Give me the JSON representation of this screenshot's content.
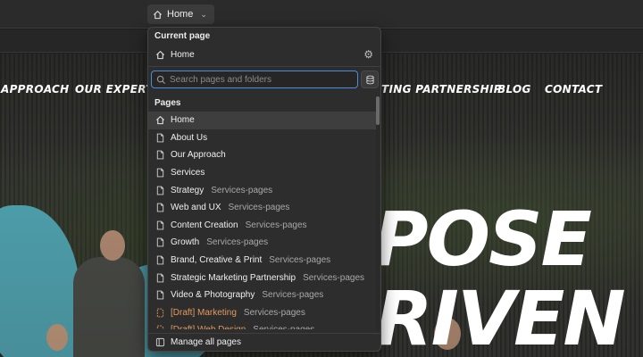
{
  "toolbar": {
    "page_button_label": "Home",
    "page_button_icon": "home-icon"
  },
  "site": {
    "nav": [
      "APPROACH",
      "OUR EXPERTIS",
      "TING PARTNERSHIP",
      "BLOG",
      "CONTACT"
    ],
    "hero_line1": "POSE",
    "hero_line2": "RIVEN"
  },
  "panel": {
    "current_heading": "Current page",
    "current_page": "Home",
    "search_placeholder": "Search pages and folders",
    "pages_heading": "Pages",
    "pages": [
      {
        "label": "Home",
        "sub": "",
        "icon": "home-icon",
        "selected": true,
        "draft": false
      },
      {
        "label": "About Us",
        "sub": "",
        "icon": "page-icon",
        "selected": false,
        "draft": false
      },
      {
        "label": "Our Approach",
        "sub": "",
        "icon": "page-icon",
        "selected": false,
        "draft": false
      },
      {
        "label": "Services",
        "sub": "",
        "icon": "page-icon",
        "selected": false,
        "draft": false
      },
      {
        "label": "Strategy",
        "sub": "Services-pages",
        "icon": "page-icon",
        "selected": false,
        "draft": false
      },
      {
        "label": "Web and UX",
        "sub": "Services-pages",
        "icon": "page-icon",
        "selected": false,
        "draft": false
      },
      {
        "label": "Content Creation",
        "sub": "Services-pages",
        "icon": "page-icon",
        "selected": false,
        "draft": false
      },
      {
        "label": "Growth",
        "sub": "Services-pages",
        "icon": "page-icon",
        "selected": false,
        "draft": false
      },
      {
        "label": "Brand, Creative & Print",
        "sub": "Services-pages",
        "icon": "page-icon",
        "selected": false,
        "draft": false
      },
      {
        "label": "Strategic Marketing Partnership",
        "sub": "Services-pages",
        "icon": "page-icon",
        "selected": false,
        "draft": false
      },
      {
        "label": "Video & Photography",
        "sub": "Services-pages",
        "icon": "page-icon",
        "selected": false,
        "draft": false
      },
      {
        "label": "[Draft] Marketing",
        "sub": "Services-pages",
        "icon": "draft-page-icon",
        "selected": false,
        "draft": true
      },
      {
        "label": "[Draft] Web Design",
        "sub": "Services-pages",
        "icon": "draft-page-icon",
        "selected": false,
        "draft": true
      }
    ],
    "footer_label": "Manage all pages"
  },
  "colors": {
    "accent_focus": "#4a8ede",
    "draft": "#e59a5d",
    "brand_teal": "#58b7c6"
  }
}
